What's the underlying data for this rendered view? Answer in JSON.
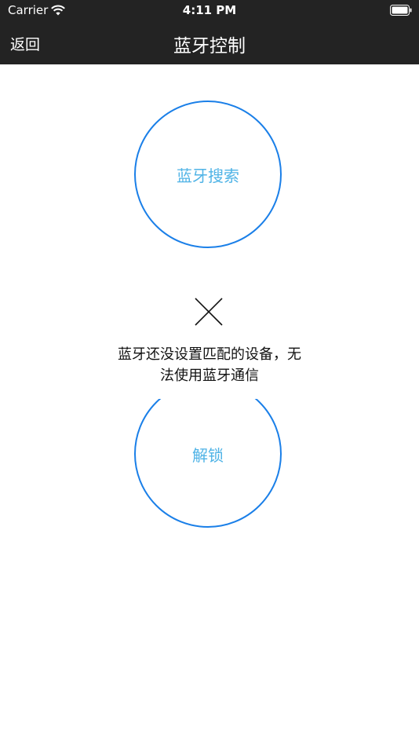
{
  "status_bar": {
    "carrier": "Carrier",
    "time": "4:11 PM"
  },
  "navbar": {
    "back_label": "返回",
    "title": "蓝牙控制"
  },
  "main": {
    "search_button_label": "蓝牙搜索",
    "unlock_button_label": "解锁",
    "message_line1": "蓝牙还没设置匹配的设备，无",
    "message_line2": "法使用蓝牙通信"
  },
  "colors": {
    "topbar_bg": "#232323",
    "circle_border": "#1a7fe8",
    "circle_text": "#4fb3e6"
  }
}
